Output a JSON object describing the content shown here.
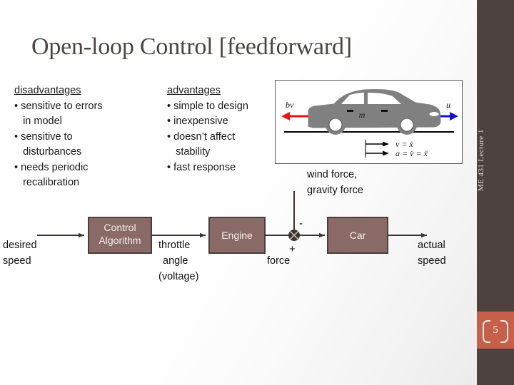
{
  "slide": {
    "title": "Open-loop Control [feedforward]",
    "page_number": "5",
    "sidebar_label": "ME 431 Lecture 1",
    "accent_color": "#c7604a",
    "sidebar_color": "#4d4240",
    "block_fill": "#8a6a66",
    "block_stroke": "#4a3d3a"
  },
  "columns": [
    {
      "heading": "disadvantages",
      "items": [
        "• sensitive to errors",
        "   in model",
        "• sensitive to",
        "   disturbances",
        "• needs periodic",
        "   recalibration"
      ]
    },
    {
      "heading": "advantages",
      "items": [
        "• simple to design",
        "• inexpensive",
        "• doesn’t affect",
        "   stability",
        "• fast response"
      ]
    }
  ],
  "car_figure": {
    "drag_label": "bv",
    "drag_color": "#ee1111",
    "input_label": "u",
    "input_color": "#1111cc",
    "mass_label": "m",
    "equation_velocity": "v = ẋ",
    "equation_acceleration": "a = v̇ = ẍ",
    "car_color": "#808080"
  },
  "diagram": {
    "input_label_line1": "desired",
    "input_label_line2": "speed",
    "block_control": "Control",
    "block_control_2": "Algorithm",
    "signal_throttle_1": "throttle",
    "signal_throttle_2": "angle",
    "signal_throttle_3": "(voltage)",
    "block_engine": "Engine",
    "signal_force": "force",
    "sum_minus": "-",
    "sum_plus": "+",
    "disturbance_1": "wind force,",
    "disturbance_2": "gravity force",
    "block_car": "Car",
    "output_label_1": "actual",
    "output_label_2": "speed"
  }
}
